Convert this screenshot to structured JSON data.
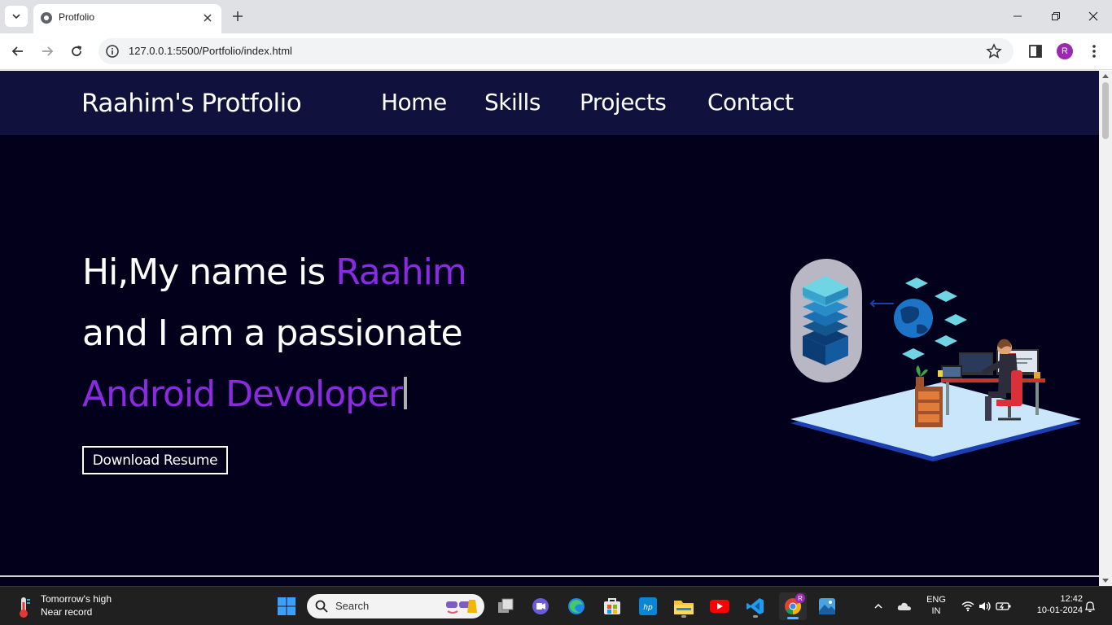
{
  "browser": {
    "tab_title": "Protfolio",
    "url": "127.0.0.1:5500/Portfolio/index.html",
    "profile_initial": "R"
  },
  "site": {
    "brand": "Raahim's Protfolio",
    "nav": [
      "Home",
      "Skills",
      "Projects",
      "Contact"
    ],
    "hero": {
      "line1_prefix": "Hi,My name is ",
      "line1_name": "Raahim",
      "line2": "and I am a passionate",
      "line3": "Android Devoloper",
      "button": "Download Resume"
    },
    "colors": {
      "nav_bg": "#10123d",
      "page_bg": "#03001c",
      "accent": "#8a2be2"
    }
  },
  "taskbar": {
    "weather_title": "Tomorrow's high",
    "weather_sub": "Near record",
    "search_placeholder": "Search",
    "lang_top": "ENG",
    "lang_bottom": "IN",
    "time": "12:42",
    "date": "10-01-2024",
    "apps": [
      "start-icon",
      "task-view-icon",
      "chat-icon",
      "edge-icon",
      "store-icon",
      "hp-icon",
      "file-explorer-icon",
      "youtube-icon",
      "vscode-icon",
      "chrome-icon",
      "photos-icon"
    ]
  }
}
